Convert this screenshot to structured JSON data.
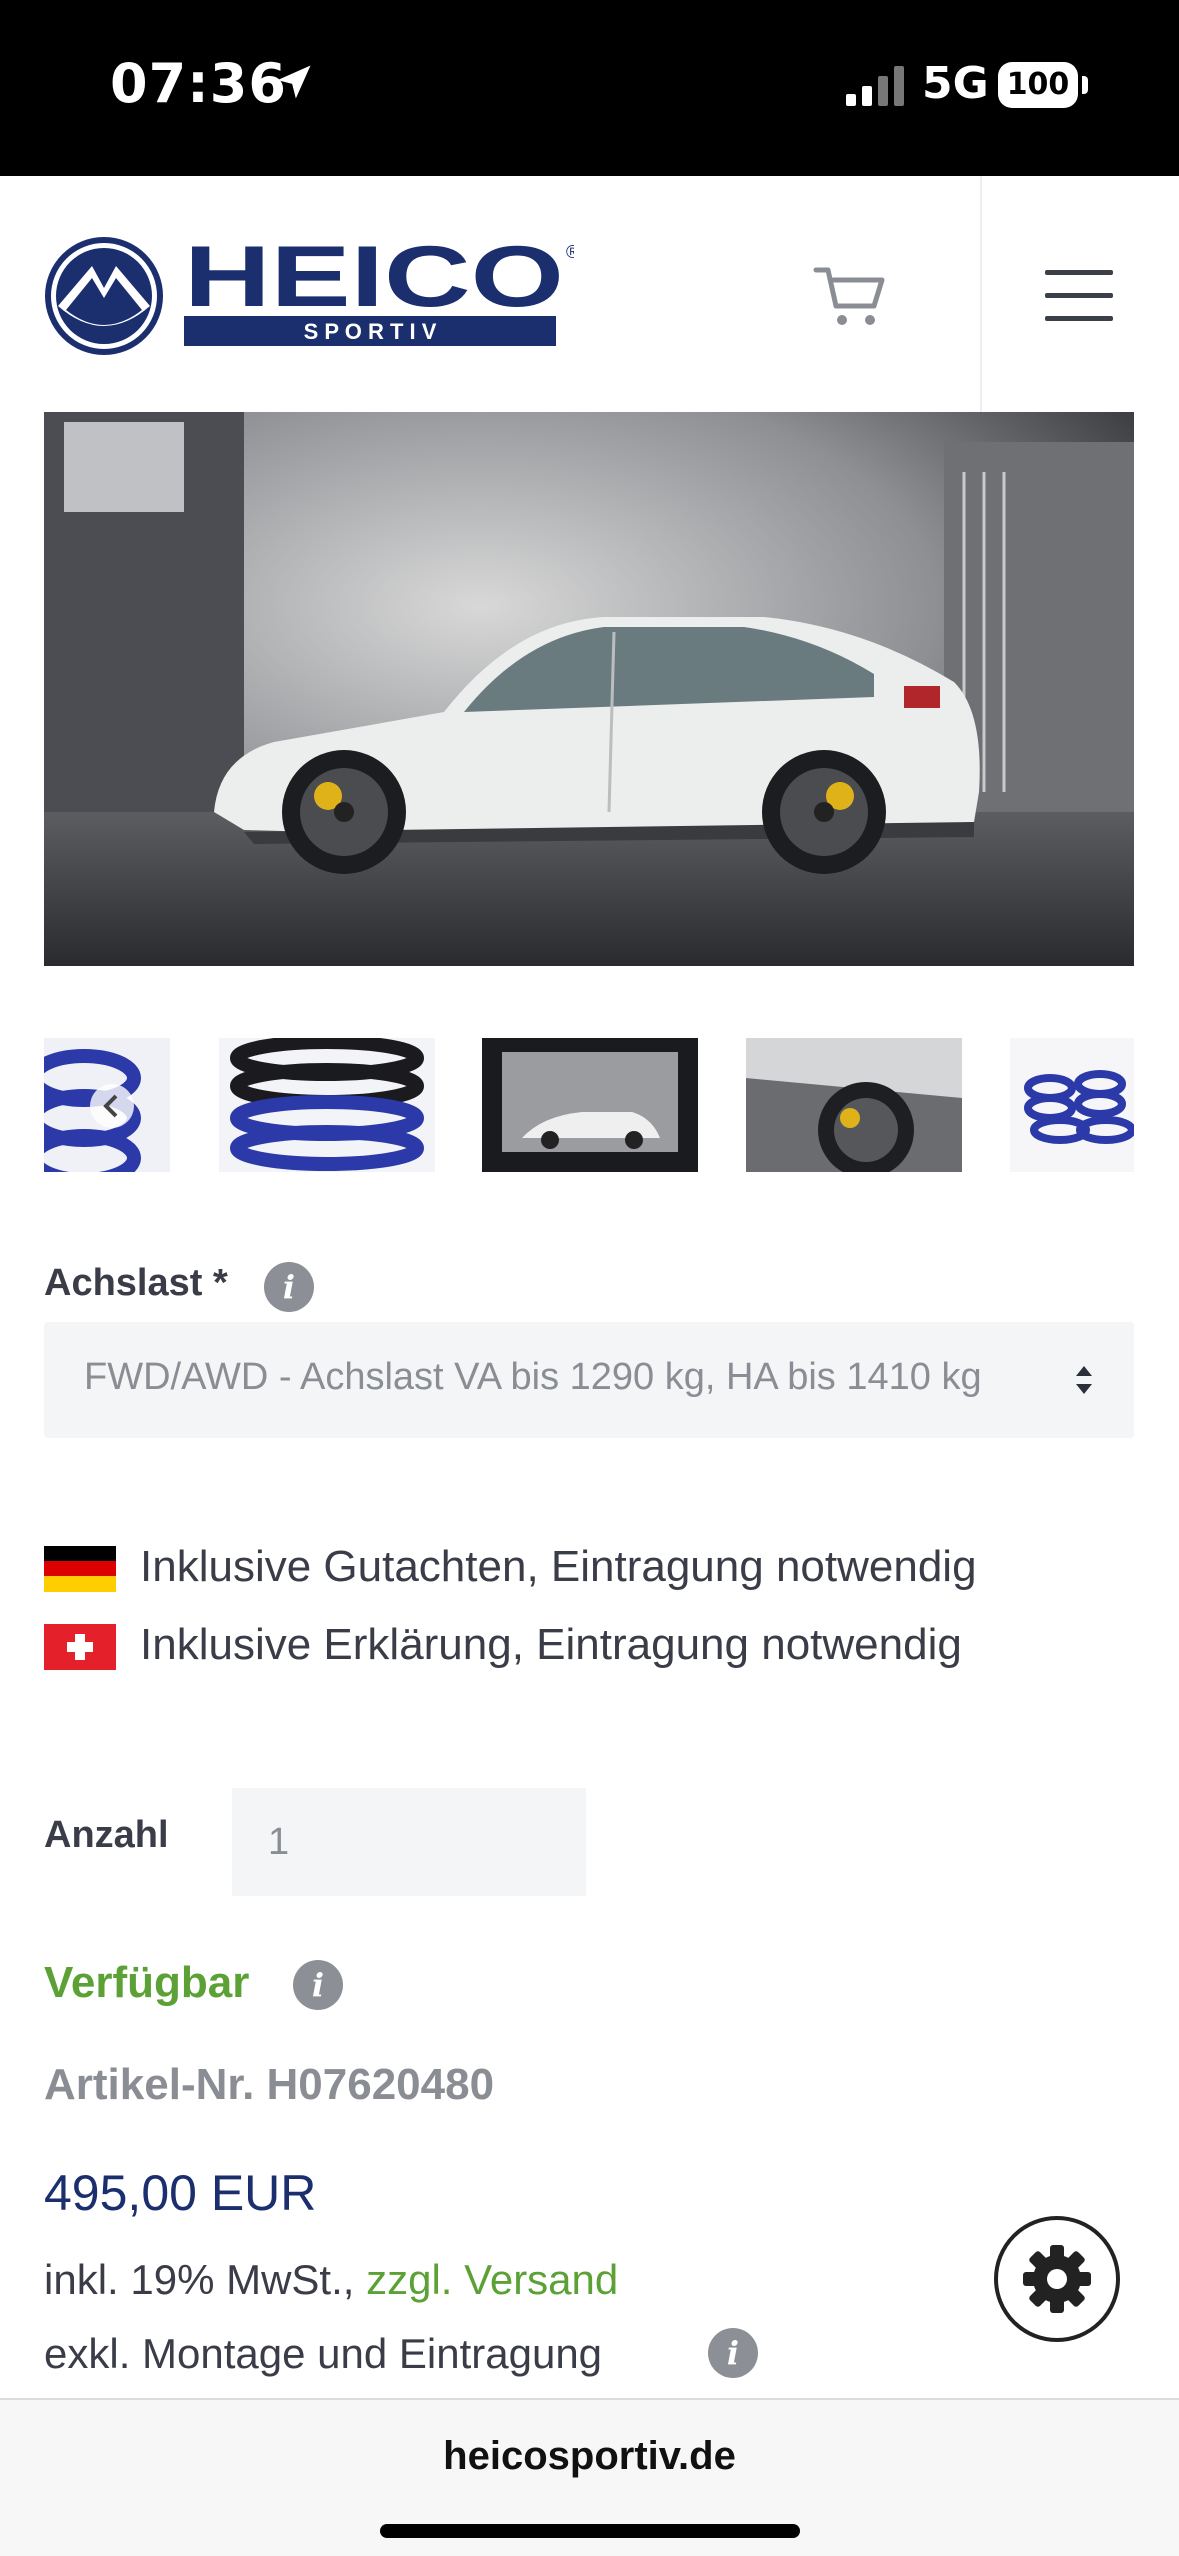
{
  "status_bar": {
    "time": "07:36",
    "network": "5G",
    "battery": "100",
    "icons": [
      "location-arrow-icon",
      "signal-icon",
      "battery-icon"
    ]
  },
  "header": {
    "logo_top": "HEICO",
    "logo_bottom": "S P O R T I V",
    "logo_mark": "®",
    "icons": [
      "cart-icon",
      "hamburger-menu-icon"
    ]
  },
  "product": {
    "axle_label": "Achslast *",
    "axle_value": "FWD/AWD - Achslast VA bis 1290 kg, HA bis 1410 kg",
    "flag_de_text": "Inklusive Gutachten, Eintragung notwendig",
    "flag_ch_text": "Inklusive Erklärung, Eintragung notwendig",
    "qty_label": "Anzahl",
    "qty_value": "1",
    "availability": "Verfügbar",
    "article_nr": "Artikel-Nr.  H07620480",
    "price": "495,00 EUR",
    "tax_prefix": "inkl. 19% MwSt., ",
    "shipping_link": "zzgl. Versand",
    "mounting": "exkl. Montage und Eintragung",
    "info_glyph": "i"
  },
  "colors": {
    "brand_blue": "#1b2e6e",
    "green": "#5ba135",
    "muted": "#8a8d93"
  },
  "browser": {
    "url": "heicosportiv.de"
  }
}
